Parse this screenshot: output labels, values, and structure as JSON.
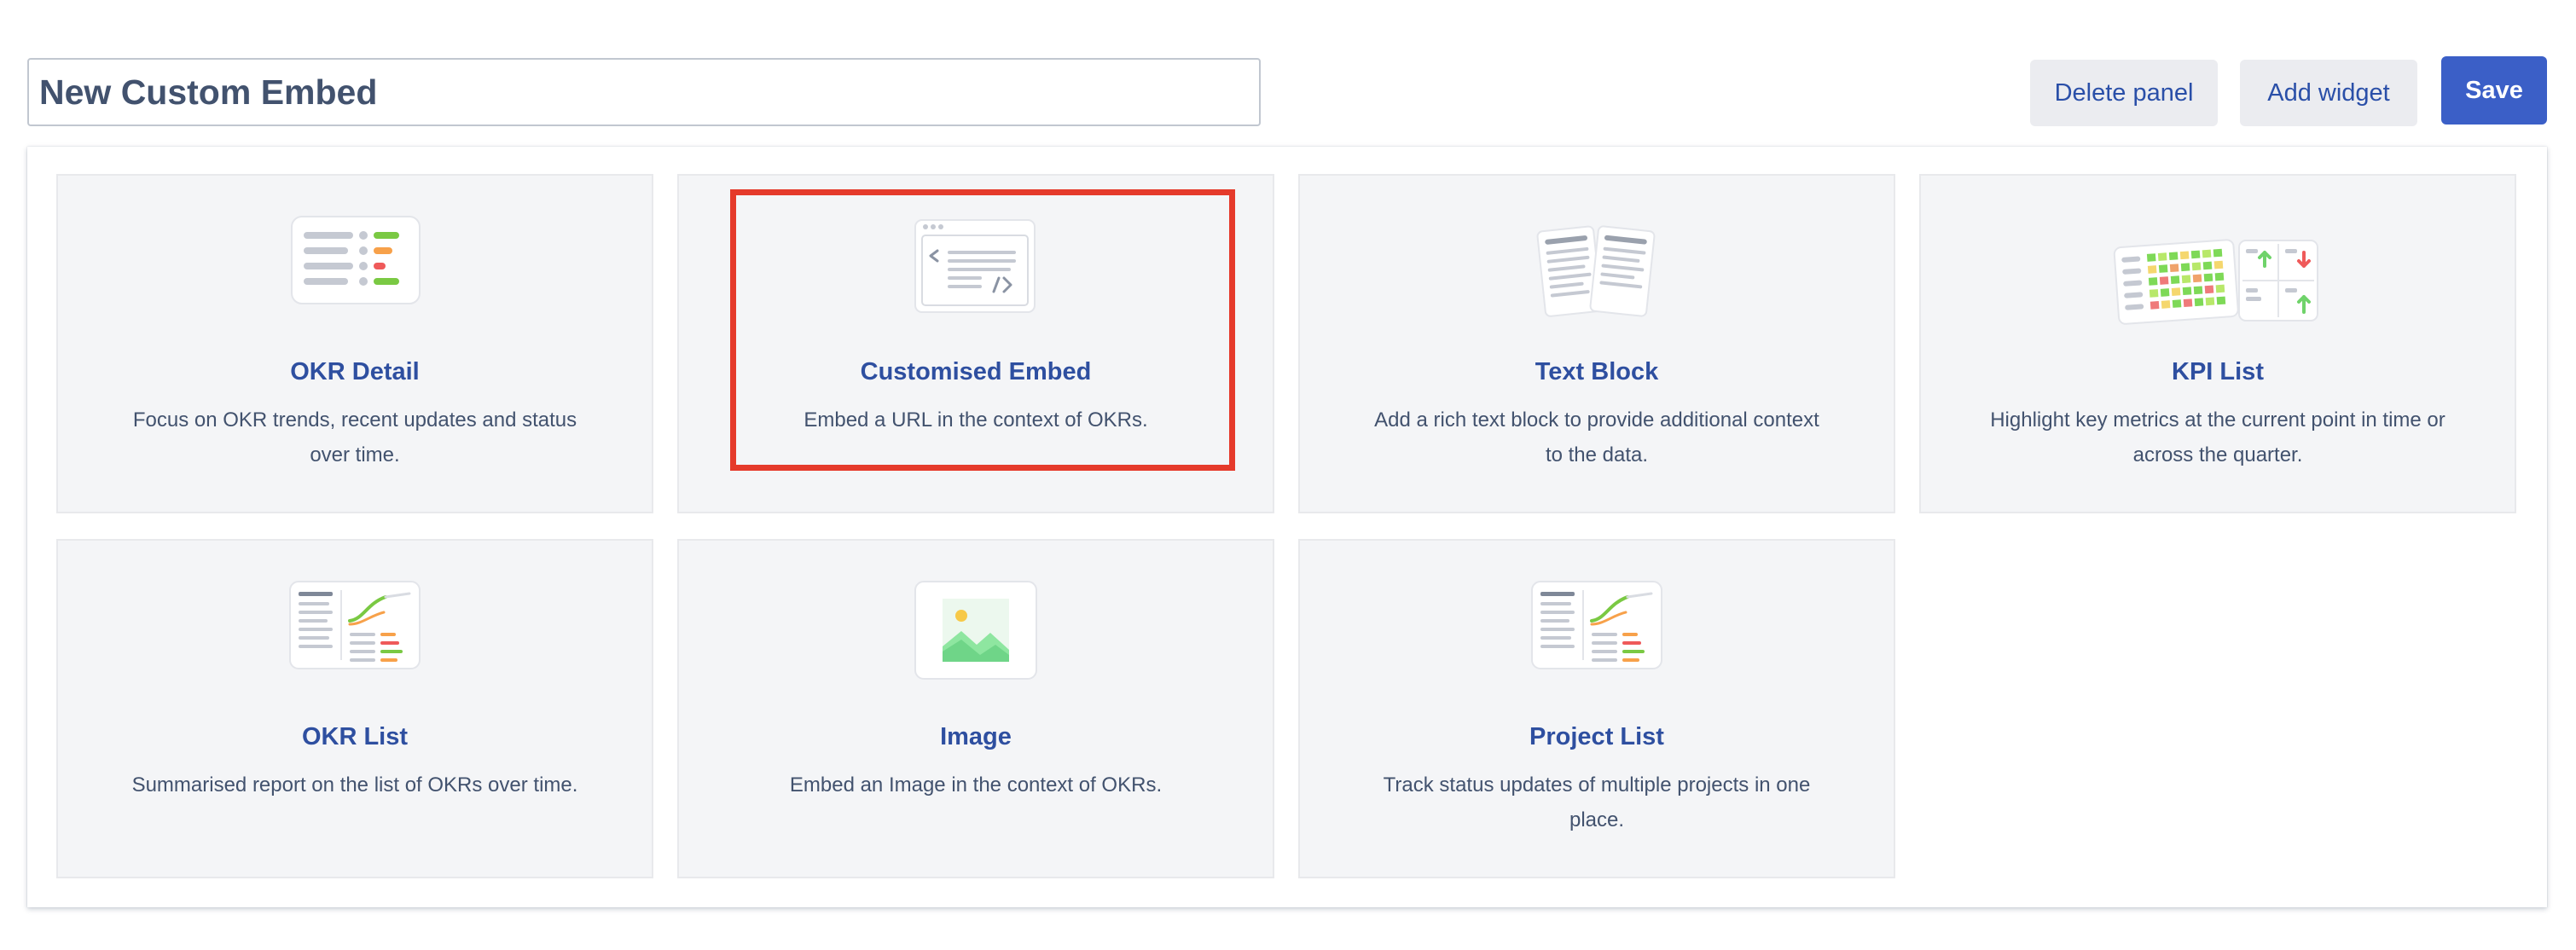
{
  "header": {
    "title_value": "New Custom Embed",
    "delete_label": "Delete panel",
    "add_widget_label": "Add widget",
    "save_label": "Save"
  },
  "colors": {
    "accent": "#3b5fc7",
    "card_title": "#2e4fa0",
    "highlight": "#e53a2b"
  },
  "widgets": [
    {
      "title": "OKR Detail",
      "description": "Focus on OKR trends, recent updates and status over time.",
      "icon": "okr-detail-icon"
    },
    {
      "title": "Customised Embed",
      "description": "Embed a URL in the context of OKRs.",
      "icon": "code-embed-icon"
    },
    {
      "title": "Text Block",
      "description": "Add a rich text block to provide additional context to the data.",
      "icon": "document-icon"
    },
    {
      "title": "KPI List",
      "description": "Highlight key metrics at the current point in time or across the quarter.",
      "icon": "kpi-heatmap-icon"
    },
    {
      "title": "OKR List",
      "description": "Summarised report on the list of OKRs over time.",
      "icon": "okr-list-icon"
    },
    {
      "title": "Image",
      "description": "Embed an Image in the context of OKRs.",
      "icon": "image-icon"
    },
    {
      "title": "Project List",
      "description": "Track status updates of multiple projects in one place.",
      "icon": "project-list-icon"
    }
  ],
  "selected_widget": "Customised Embed"
}
